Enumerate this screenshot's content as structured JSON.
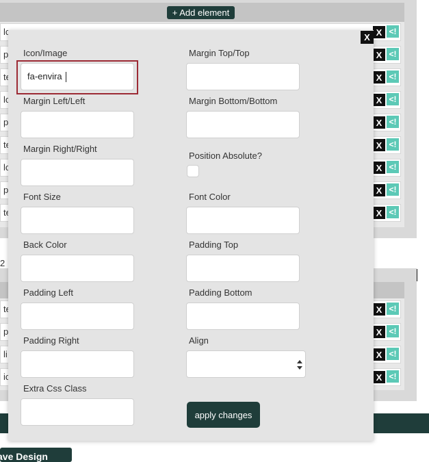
{
  "toolbar": {
    "add_element_label": "+ Add element"
  },
  "panel_top": {
    "row_prefixes": [
      "lc",
      "p",
      "te",
      "lc",
      "p",
      "te",
      "lc",
      "p",
      "te"
    ],
    "remove_label": "X",
    "move_label": "<!"
  },
  "panel_bottom": {
    "row_prefixes": [
      "te",
      "p",
      "li",
      "ic"
    ],
    "remove_label": "X",
    "move_label": "<!",
    "index_label": "2",
    "close_label": "X"
  },
  "save_design_label": "ave Design",
  "modal": {
    "close_label": "X",
    "fields": {
      "icon_image": {
        "label": "Icon/Image",
        "value": "fa-envira"
      },
      "margin_top": {
        "label": "Margin Top/Top",
        "value": ""
      },
      "margin_left": {
        "label": "Margin Left/Left",
        "value": ""
      },
      "margin_bottom": {
        "label": "Margin Bottom/Bottom",
        "value": ""
      },
      "margin_right": {
        "label": "Margin Right/Right",
        "value": ""
      },
      "position_absolute": {
        "label": "Position Absolute?",
        "checked": false
      },
      "font_size": {
        "label": "Font Size",
        "value": ""
      },
      "font_color": {
        "label": "Font Color",
        "value": ""
      },
      "back_color": {
        "label": "Back Color",
        "value": ""
      },
      "padding_top": {
        "label": "Padding Top",
        "value": ""
      },
      "padding_left": {
        "label": "Padding Left",
        "value": ""
      },
      "padding_bottom": {
        "label": "Padding Bottom",
        "value": ""
      },
      "padding_right": {
        "label": "Padding Right",
        "value": ""
      },
      "align": {
        "label": "Align",
        "value": ""
      },
      "extra_css": {
        "label": "Extra Css Class",
        "value": ""
      }
    },
    "apply_label": "apply changes"
  },
  "colors": {
    "accent_dark": "#1f3d3a",
    "move_button": "#5cc9b6",
    "highlight_border": "#9c2a34"
  }
}
